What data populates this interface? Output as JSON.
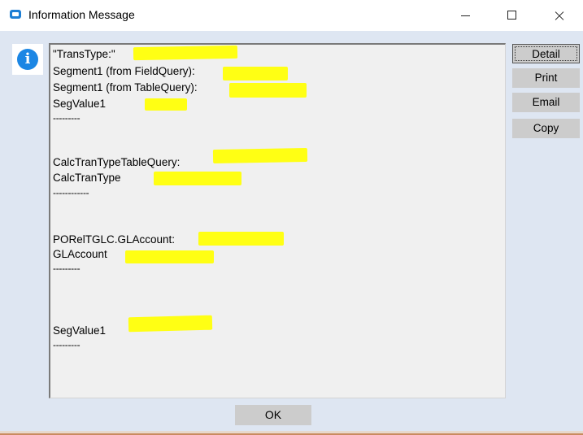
{
  "window": {
    "title": "Information Message"
  },
  "message": {
    "lines": [
      "\"TransType:\"",
      "Segment1 (from FieldQuery):",
      "Segment1 (from TableQuery):",
      "SegValue1",
      "---------",
      "CalcTranTypeTableQuery:",
      "CalcTranType",
      "------------",
      "PORelTGLC.GLAccount:",
      "GLAccount",
      "---------",
      "SegValue1",
      "---------"
    ]
  },
  "side_buttons": {
    "detail": "Detail",
    "print": "Print",
    "email": "Email",
    "copy": "Copy"
  },
  "footer": {
    "ok": "OK"
  },
  "colors": {
    "highlight": "#ffff14",
    "info_icon": "#1b86e4",
    "client_bg": "#dee6f2"
  },
  "icons": {
    "app": "app-icon",
    "info": "info-icon"
  }
}
